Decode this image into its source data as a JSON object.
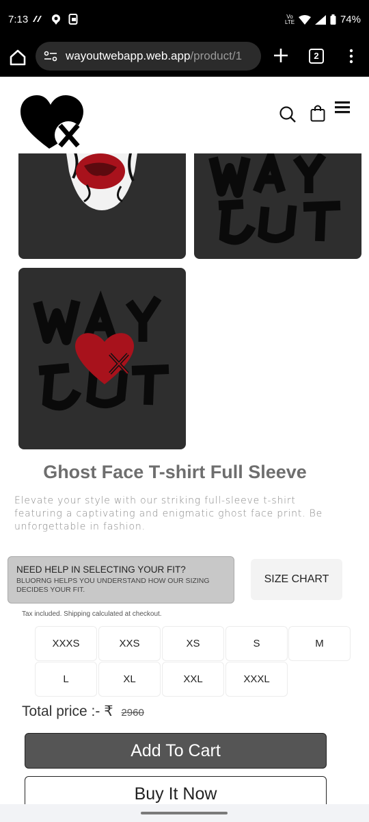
{
  "status_bar": {
    "time": "7:13",
    "network_label": "Vo LTE",
    "battery": "74%"
  },
  "browser": {
    "url_domain": "wayoutwebapp.web.app",
    "url_path": "/product/1",
    "tab_count": "2"
  },
  "gallery": {
    "tile_color": "#2e2e2e",
    "accent_red": "#a8121c"
  },
  "product": {
    "title": "Ghost Face T-shirt Full Sleeve",
    "description": "Elevate your style with our striking full-sleeve t-shirt featuring a captivating and enigmatic ghost face print. Be unforgettable in fashion."
  },
  "fit_help": {
    "heading": "NEED HELP IN SELECTING YOUR FIT?",
    "subtext": "BLUORNG HELPS YOU UNDERSTAND HOW OUR SIZING DECIDES YOUR FIT.",
    "size_chart_label": "SIZE CHART"
  },
  "tax_note": "Tax included. Shipping calculated at checkout.",
  "sizes": [
    "XXXS",
    "XXS",
    "XS",
    "S",
    "M",
    "L",
    "XL",
    "XXL",
    "XXXL"
  ],
  "pricing": {
    "label": "Total price :- ₹",
    "original_price": "2960"
  },
  "actions": {
    "add_to_cart": "Add To Cart",
    "buy_now": "Buy It Now"
  }
}
